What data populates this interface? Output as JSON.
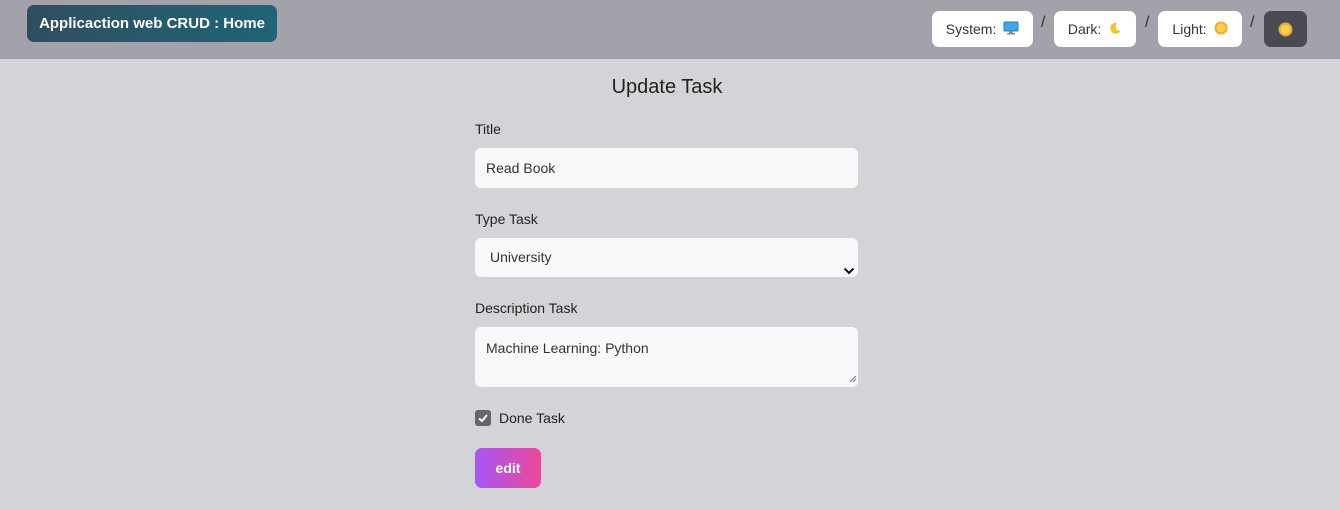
{
  "header": {
    "home_label": "Applicaction web CRUD : Home",
    "themes": [
      {
        "label": "System:",
        "icon": "monitor-icon"
      },
      {
        "label": "Dark:",
        "icon": "moon-icon"
      },
      {
        "label": "Light:",
        "icon": "sun-icon"
      }
    ],
    "separator": "/",
    "toggle_icon": "sun-icon"
  },
  "form": {
    "title": "Update Task",
    "title_label": "Title",
    "title_value": "Read Book",
    "type_label": "Type Task",
    "type_value": "University",
    "description_label": "Description Task",
    "description_value": "Machine Learning: Python",
    "done_label": "Done Task",
    "done_checked": true,
    "submit_label": "edit"
  },
  "colors": {
    "header_bg": "#a3a2aa",
    "page_bg": "#d4d3d8",
    "home_button": "#245a6d",
    "edit_gradient_start": "#a855f7",
    "edit_gradient_end": "#ec4899"
  }
}
